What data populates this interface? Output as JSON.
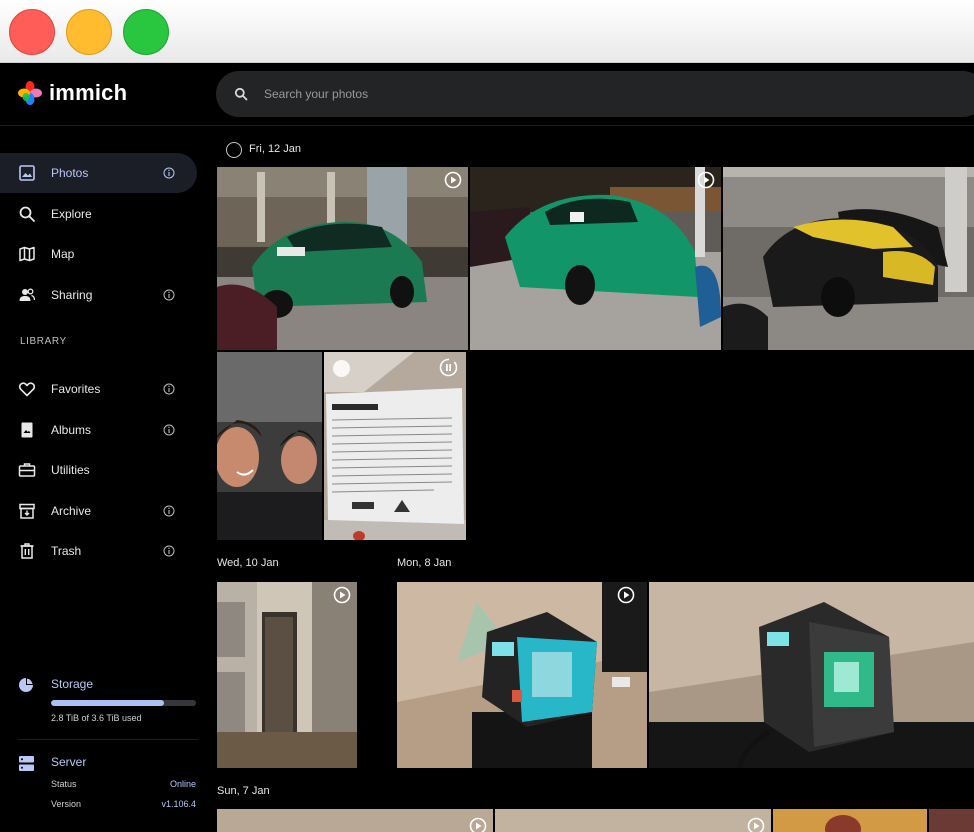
{
  "app": {
    "name": "immich"
  },
  "search": {
    "placeholder": "Search your photos"
  },
  "sidebar": {
    "items": [
      {
        "label": "Photos"
      },
      {
        "label": "Explore"
      },
      {
        "label": "Map"
      },
      {
        "label": "Sharing"
      }
    ],
    "section_label": "LIBRARY",
    "library_items": [
      {
        "label": "Favorites"
      },
      {
        "label": "Albums"
      },
      {
        "label": "Utilities"
      },
      {
        "label": "Archive"
      },
      {
        "label": "Trash"
      }
    ],
    "storage": {
      "title": "Storage",
      "usage_text": "2.8 TiB of 3.6 TiB used",
      "used_fraction": 0.78
    },
    "server": {
      "title": "Server",
      "status_label": "Status",
      "status_value": "Online",
      "version_label": "Version",
      "version_value": "v1.106.4"
    }
  },
  "timeline": {
    "groups": [
      {
        "date": "Fri, 12 Jan"
      },
      {
        "date": "Wed, 10 Jan"
      },
      {
        "date": "Mon, 8 Jan"
      },
      {
        "date": "Sun, 7 Jan"
      }
    ]
  },
  "colors": {
    "accent": "#adc0f2",
    "online": "#b9c8f5",
    "background": "#000000",
    "sidebar_active": "#1b1e26"
  }
}
